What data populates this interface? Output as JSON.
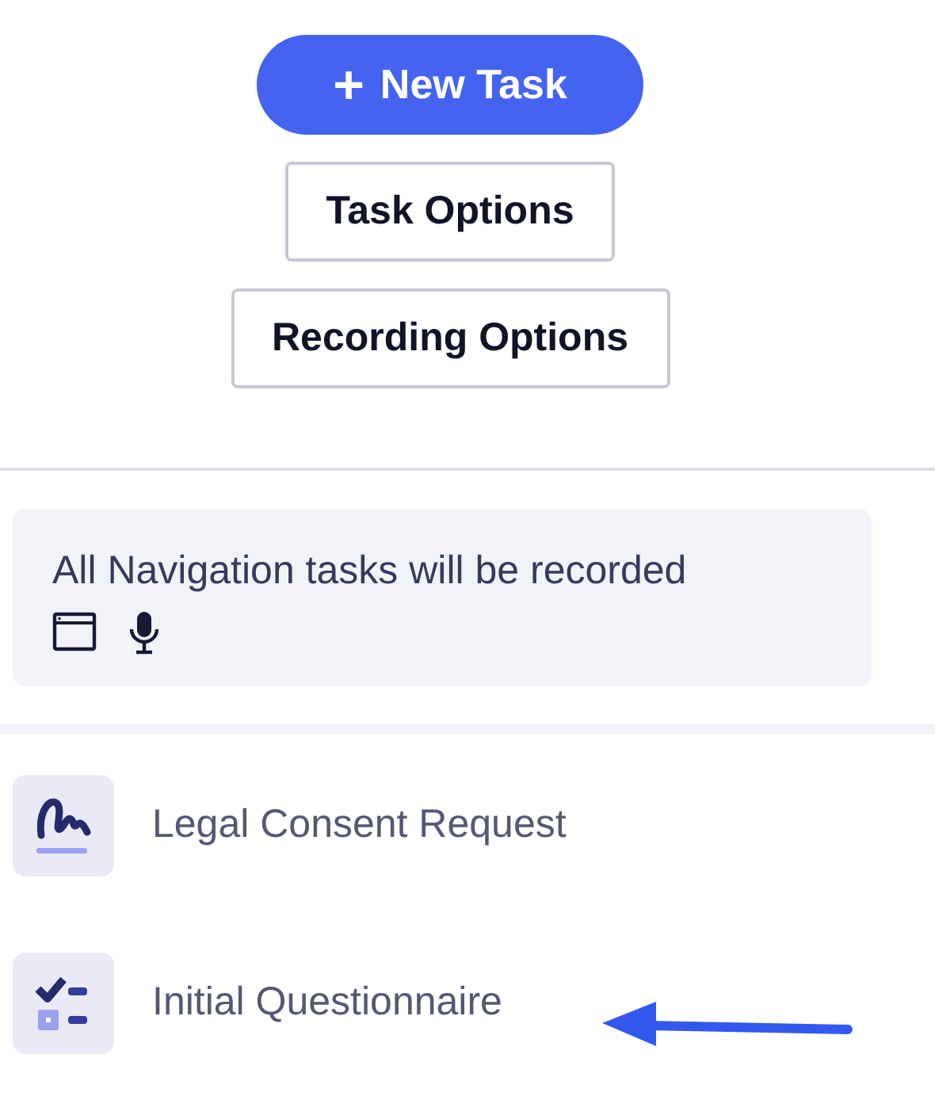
{
  "primary_button": {
    "label": "New Task",
    "icon": "+"
  },
  "buttons": [
    "Task Options",
    "Recording Options"
  ],
  "notice": {
    "text": "All Navigation tasks will be recorded"
  },
  "tasks": [
    {
      "kind": "signature",
      "label": "Legal Consent Request"
    },
    {
      "kind": "checklist",
      "label": "Initial Questionnaire"
    }
  ]
}
